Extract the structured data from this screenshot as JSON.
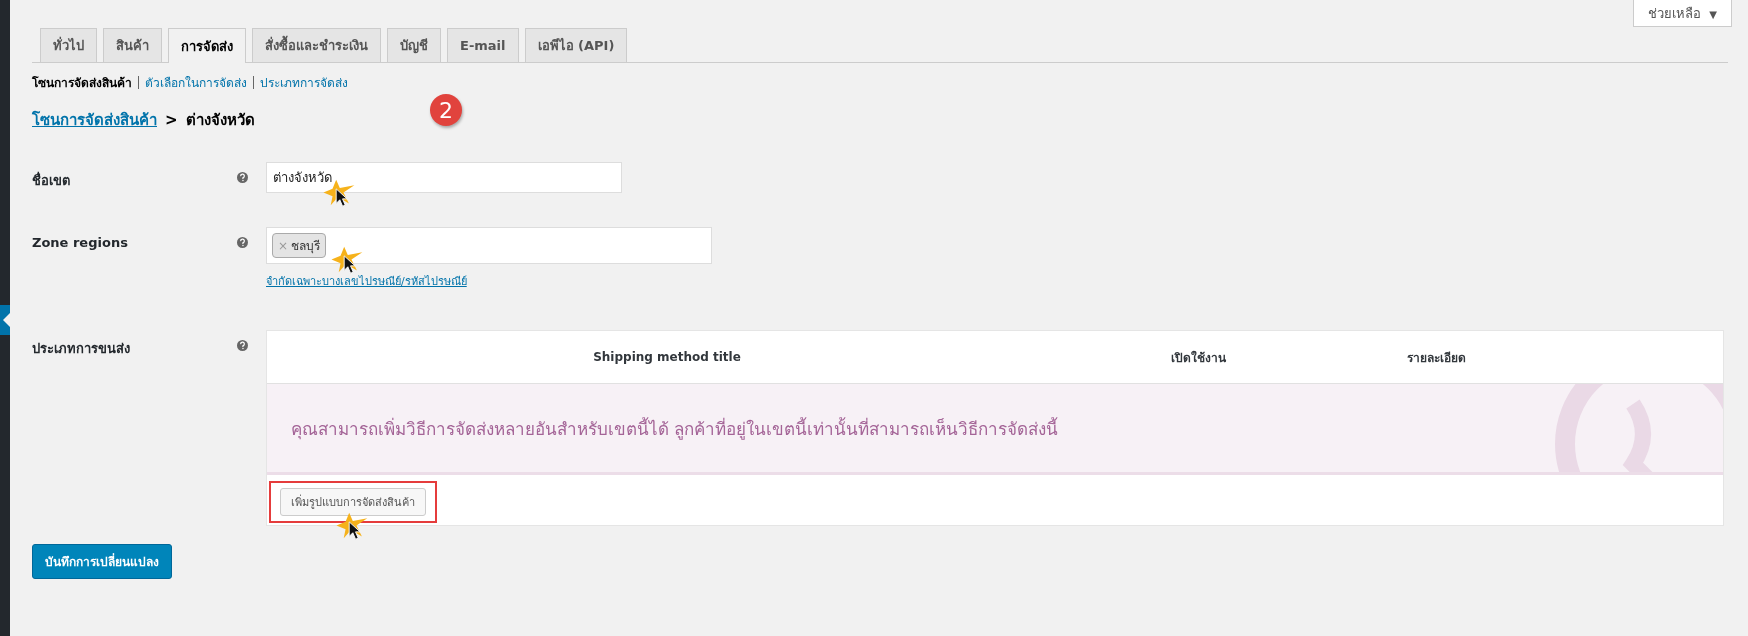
{
  "help_button": {
    "label": "ช่วยเหลือ",
    "caret": "▼"
  },
  "tabs": [
    {
      "label": "ทั่วไป",
      "selected": false
    },
    {
      "label": "สินค้า",
      "selected": false
    },
    {
      "label": "การจัดส่ง",
      "selected": true
    },
    {
      "label": "สั่งซื้อและชำระเงิน",
      "selected": false
    },
    {
      "label": "บัญชี",
      "selected": false
    },
    {
      "label": "E-mail",
      "selected": false
    },
    {
      "label": "เอพีไอ (API)",
      "selected": false
    }
  ],
  "subnav": [
    {
      "label": "โซนการจัดส่งสินค้า",
      "selected": true
    },
    {
      "label": "ตัวเลือกในการจัดส่ง",
      "selected": false
    },
    {
      "label": "ประเภทการจัดส่ง",
      "selected": false
    }
  ],
  "breadcrumb": {
    "link": "โซนการจัดส่งสินค้า",
    "separator": ">",
    "current": "ต่างจังหวัด"
  },
  "step_badge": "2",
  "zone_name": {
    "label": "ชื่อเขต",
    "value": "ต่างจังหวัด"
  },
  "zone_regions": {
    "label": "Zone regions",
    "tags": [
      {
        "remove": "×",
        "label": "ชลบุรี"
      }
    ],
    "postcode_link": "จำกัดเฉพาะบางเลขไปรษณีย์/รหัสไปรษณีย์"
  },
  "shipping_methods": {
    "label": "ประเภทการขนส่ง",
    "columns": [
      "Shipping method title",
      "เปิดใช้งาน",
      "รายละเอียด"
    ],
    "empty_message": "คุณสามารถเพิ่มวิธีการจัดส่งหลายอันสำหรับเขตนี้ได้ ลูกค้าที่อยู่ในเขตนี้เท่านั้นที่สามารถเห็นวิธีการจัดส่งนี้",
    "add_button": "เพิ่มรูปแบบการจัดส่งสินค้า"
  },
  "save_button": "บันทึกการเปลี่ยนแปลง"
}
